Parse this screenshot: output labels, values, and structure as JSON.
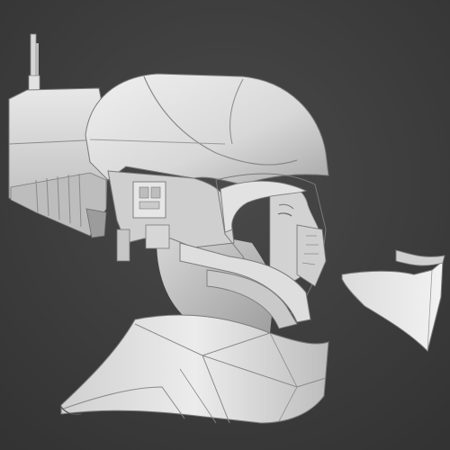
{
  "scene": {
    "subject": "helmet-3d-model",
    "parts": [
      "helmet-shell",
      "antenna",
      "side-module",
      "face-guard",
      "visor-strip",
      "neck-collar",
      "head-model",
      "detached-face-shield"
    ],
    "colors": {
      "background_top": "#4a4a4a",
      "background_bottom": "#333333",
      "surface_light": "#e6e6e6",
      "surface_mid": "#bfbfbf",
      "surface_dark": "#8a8a8a",
      "edge_line": "#6e6e6e",
      "skin": "#cfcfcf"
    }
  }
}
